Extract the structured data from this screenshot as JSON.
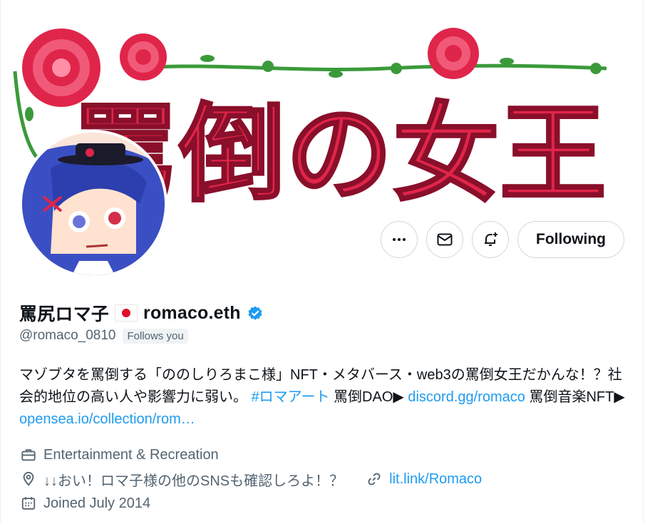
{
  "banner": {
    "title": "罵倒の女王"
  },
  "profile": {
    "display_name": "罵尻ロマ子",
    "name_suffix": "romaco.eth",
    "handle": "@romaco_0810",
    "follows_you": "Follows you",
    "verified_color": "#1d9bf0"
  },
  "actions": {
    "following_label": "Following",
    "more_icon": "more-icon",
    "message_icon": "mail-icon",
    "notify_icon": "bell-plus-icon"
  },
  "bio": {
    "text_1": "マゾブタを罵倒する「ののしりろまこ様」NFT・メタバース・web3の罵倒女王だかんな！？社会的地位の高い人や影響力に弱い。",
    "hashtag": "#ロマアート",
    "text_2": " 罵倒DAO▶",
    "link_1": "discord.gg/romaco",
    "text_3": "罵倒音楽NFT▶ ",
    "link_2": "opensea.io/collection/rom…"
  },
  "meta": {
    "category": "Entertainment & Recreation",
    "location": "↓↓おい！ロマ子様の他のSNSも確認しろよ！？",
    "website": "lit.link/Romaco",
    "joined": "Joined July 2014"
  },
  "colors": {
    "accent": "#1d9bf0",
    "rose": "#e0254a",
    "stem": "#3a9a3a"
  }
}
